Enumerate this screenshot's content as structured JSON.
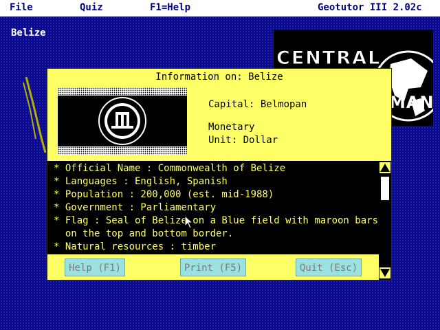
{
  "menubar": {
    "file": "File",
    "quiz": "Quiz",
    "help": "F1=Help",
    "app_title": "Geotutor III 2.02c"
  },
  "country_label": "Belize",
  "banner": {
    "line1": "CENTRAL",
    "line2": "MAN"
  },
  "dialog": {
    "title": "Information on: Belize",
    "capital": "Capital: Belmopan",
    "monetary": "Monetary\nUnit: Dollar",
    "facts": [
      "* Official Name : Commonwealth of Belize",
      "* Languages : English, Spanish",
      "* Population : 200,000 (est. mid-1988)",
      "* Government : Parliamentary",
      "* Flag : Seal of Belize on a Blue field with maroon bars",
      "  on the top and bottom border.",
      "* Natural resources : timber"
    ],
    "buttons": {
      "help": "Help (F1)",
      "print": "Print (F5)",
      "quit": "Quit (Esc)"
    }
  },
  "colors": {
    "background": "#0a0a86",
    "dialog": "#ffff66",
    "button": "#9be1e1"
  }
}
